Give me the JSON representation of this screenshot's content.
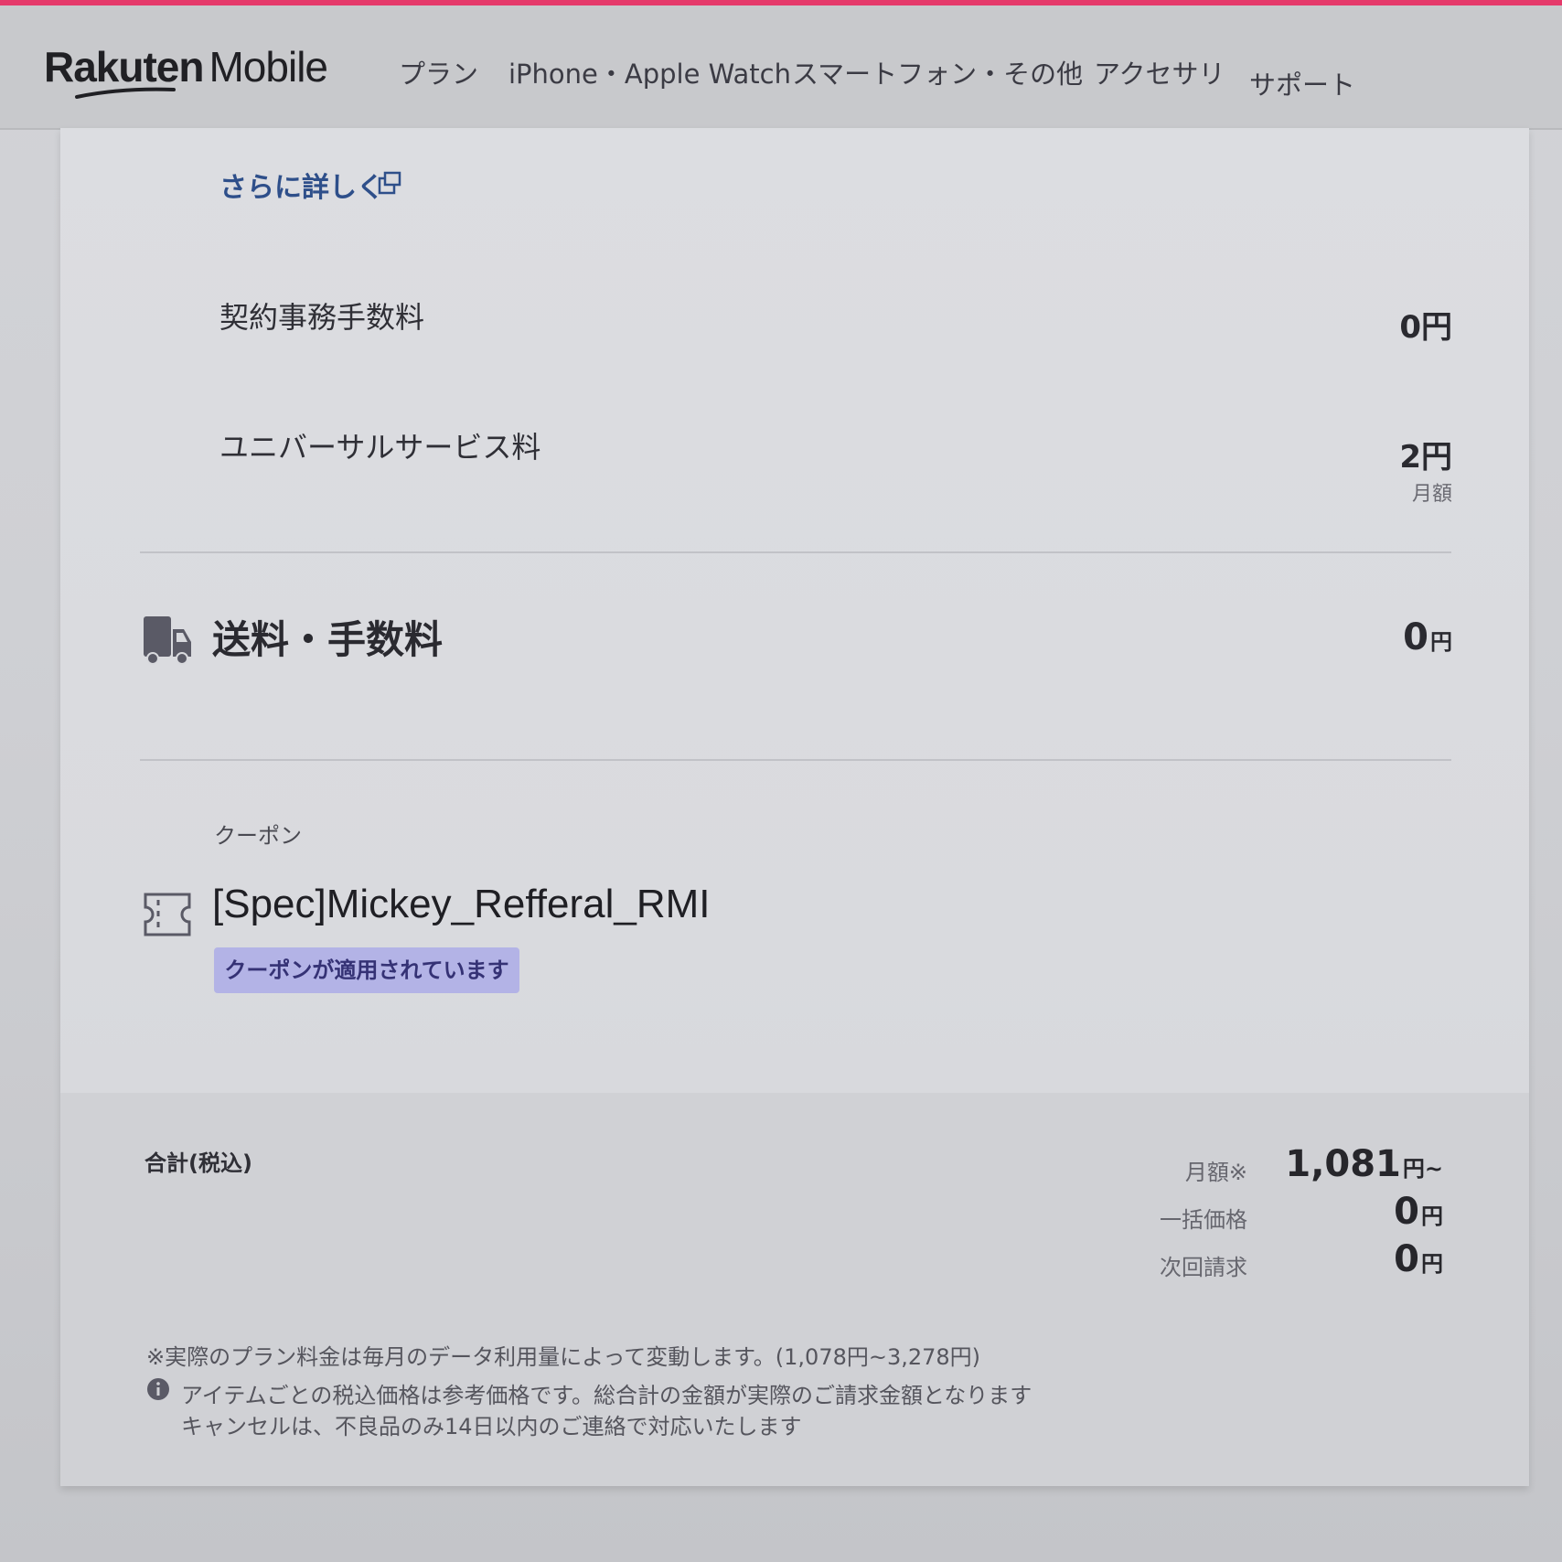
{
  "header": {
    "logo": {
      "brand": "Rakuten",
      "product": "Mobile"
    },
    "nav": [
      {
        "label": "プラン"
      },
      {
        "label": "iPhone・Apple Watch"
      },
      {
        "label": "スマートフォン・その他"
      },
      {
        "label": "アクセサリ"
      },
      {
        "label": "サポート"
      }
    ],
    "accent_color": "#e5396a"
  },
  "details": {
    "more_link": "さらに詳しく",
    "fees": [
      {
        "label": "契約事務手数料",
        "value": "0円"
      },
      {
        "label": "ユニバーサルサービス料",
        "value": "2円",
        "sub": "月額"
      }
    ]
  },
  "shipping": {
    "title": "送料・手数料",
    "value": "0",
    "unit": "円",
    "icon": "truck-icon"
  },
  "coupon": {
    "section_label": "クーポン",
    "name": "[Spec]Mickey_Refferal_RMI",
    "badge": "クーポンが適用されています",
    "icon": "ticket-icon",
    "badge_color": "#b3b3e6"
  },
  "summary": {
    "title": "合計(税込)",
    "rows": [
      {
        "label": "月額※",
        "value": "1,081",
        "unit": "円~"
      },
      {
        "label": "一括価格",
        "value": "0",
        "unit": "円"
      },
      {
        "label": "次回請求",
        "value": "0",
        "unit": "円"
      }
    ],
    "notes": [
      "※実際のプラン料金は毎月のデータ利用量によって変動します。(1,078円~3,278円)",
      "アイテムごとの税込価格は参考価格です。総合計の金額が実際のご請求金額となります",
      "キャンセルは、不良品のみ14日以内のご連絡で対応いたします"
    ]
  }
}
